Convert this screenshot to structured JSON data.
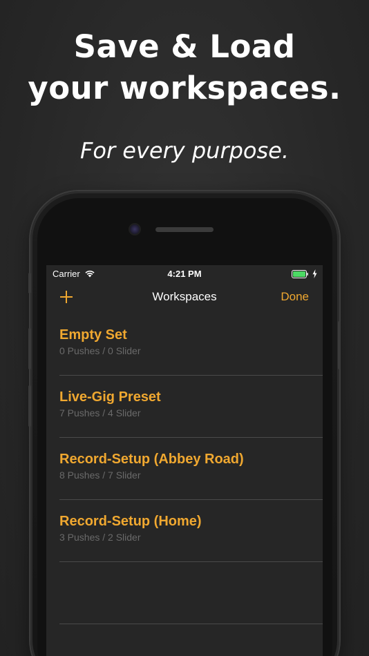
{
  "headline": {
    "line1": "Save & Load",
    "line2": "your workspaces."
  },
  "tagline": "For every purpose.",
  "status_bar": {
    "carrier": "Carrier",
    "time": "4:21 PM",
    "wifi_icon": "wifi-icon",
    "battery_icon": "battery-icon",
    "charge_icon": "charging-bolt-icon"
  },
  "nav": {
    "add_icon": "plus-icon",
    "title": "Workspaces",
    "done_label": "Done"
  },
  "workspaces": [
    {
      "name": "Empty Set",
      "details": "0 Pushes / 0 Slider"
    },
    {
      "name": "Live-Gig Preset",
      "details": "7 Pushes / 4 Slider"
    },
    {
      "name": "Record-Setup (Abbey Road)",
      "details": "8 Pushes / 7 Slider"
    },
    {
      "name": "Record-Setup (Home)",
      "details": "3 Pushes / 2 Slider"
    }
  ],
  "colors": {
    "accent": "#f0a830",
    "background": "#262626",
    "secondary_text": "#6a6a6a",
    "battery": "#4cd964"
  }
}
